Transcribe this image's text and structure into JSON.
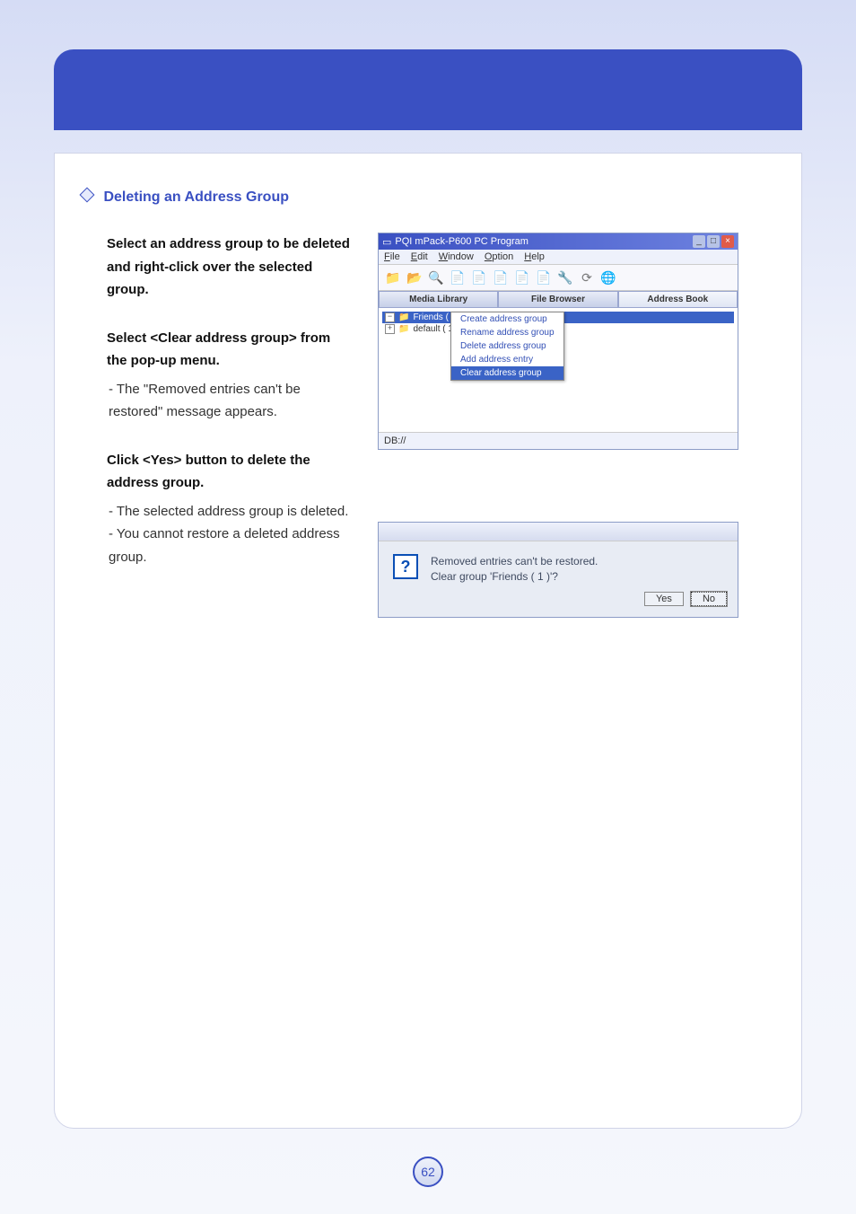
{
  "heading": "Deleting an Address Group",
  "steps": {
    "step1_bold": "Select an address group to be deleted and right-click over the selected group.",
    "step2_bold": "Select <Clear address group> from the pop-up menu.",
    "step2_detail": "- The \"Removed entries can't be restored\" message appears.",
    "step3_bold": "Click <Yes> button to delete the address group.",
    "step3_detail1": "- The selected address group is deleted.",
    "step3_detail2": "- You cannot restore a deleted address group."
  },
  "app_window": {
    "title": "PQI mPack-P600 PC Program",
    "menus": [
      "File",
      "Edit",
      "Window",
      "Option",
      "Help"
    ],
    "tabs": {
      "media": "Media Library",
      "file": "File Browser",
      "addr": "Address Book"
    },
    "tree": {
      "item1": "Friends ( 1 )",
      "item2": "default ( 1 )"
    },
    "context_menu": {
      "create": "Create address group",
      "rename": "Rename address group",
      "delete": "Delete address group",
      "add_entry": "Add address entry",
      "clear": "Clear address group"
    },
    "status": "DB://"
  },
  "dialog": {
    "line1": "Removed entries can't be restored.",
    "line2": "Clear group 'Friends ( 1 )'?",
    "yes": "Yes",
    "no": "No"
  },
  "page_number": "62",
  "icons": {
    "q": "?"
  }
}
